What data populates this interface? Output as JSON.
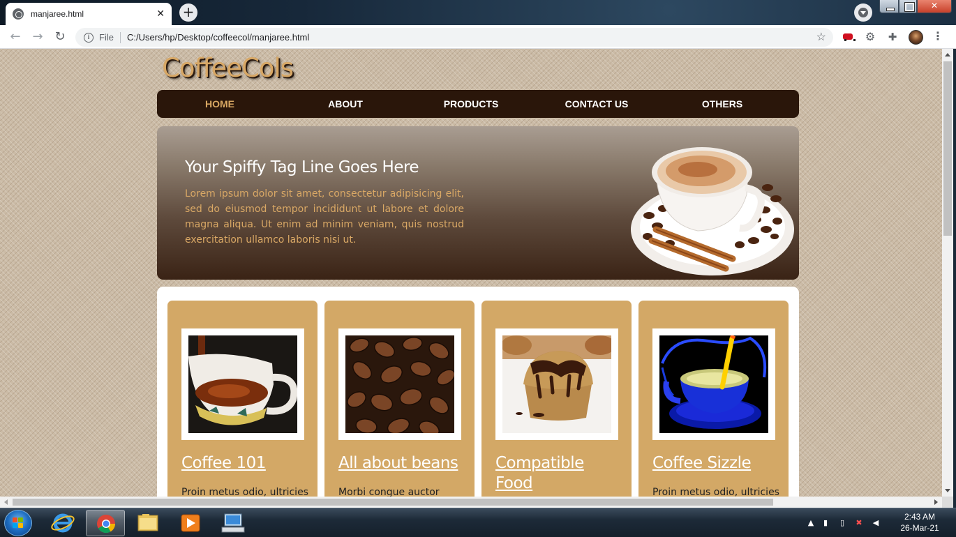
{
  "browser": {
    "tab_title": "manjaree.html",
    "tab_close": "✕",
    "new_tab": "+",
    "omnibox": {
      "scheme_label": "File",
      "url": "C:/Users/hp/Desktop/coffeecol/manjaree.html"
    }
  },
  "site": {
    "logo": "CoffeeCols",
    "nav": [
      {
        "label": "HOME",
        "active": true
      },
      {
        "label": "ABOUT",
        "active": false
      },
      {
        "label": "PRODUCTS",
        "active": false
      },
      {
        "label": "CONTACT US",
        "active": false
      },
      {
        "label": "OTHERS",
        "active": false
      }
    ],
    "hero": {
      "title": "Your Spiffy Tag Line Goes Here",
      "body": "Lorem ipsum dolor sit amet, consectetur adipisicing elit, sed do eiusmod tempor incididunt ut labore et dolore magna aliqua. Ut enim ad minim veniam, quis nostrud exercitation ullamco laboris nisi ut."
    },
    "cards": [
      {
        "title": "Coffee 101",
        "text": "Proin metus odio, ultricies",
        "image_icon": "coffee-cup-pour-image"
      },
      {
        "title": "All about beans",
        "text": "Morbi congue auctor",
        "image_icon": "coffee-beans-image"
      },
      {
        "title": "Compatible Food",
        "text": "",
        "image_icon": "muffin-image"
      },
      {
        "title": "Coffee Sizzle",
        "text": "Proin metus odio, ultricies",
        "image_icon": "blue-cup-image"
      }
    ]
  },
  "taskbar": {
    "clock_time": "2:43 AM",
    "clock_date": "26-Mar-21",
    "apps": [
      "internet-explorer-icon",
      "chrome-icon",
      "file-explorer-icon",
      "media-player-icon",
      "remote-desktop-icon"
    ]
  },
  "colors": {
    "accent_gold": "#d3a866",
    "nav_bg": "#2a160a",
    "nav_active": "#d9a863",
    "page_bg": "#cbbba6"
  }
}
